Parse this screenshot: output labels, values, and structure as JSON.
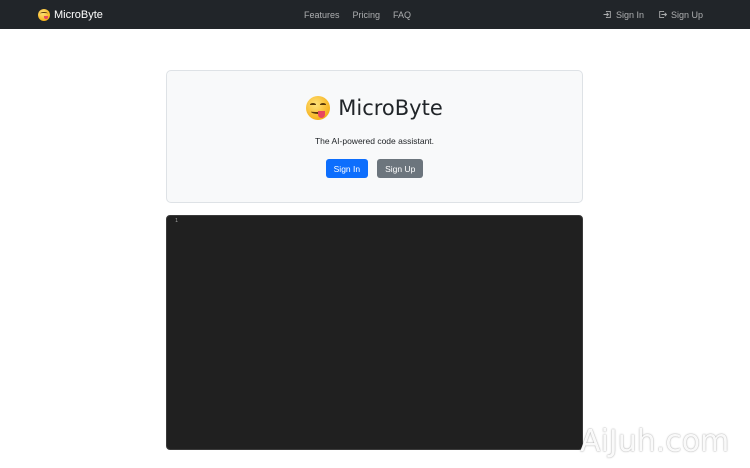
{
  "navbar": {
    "brand": "MicroByte",
    "links": [
      "Features",
      "Pricing",
      "FAQ"
    ],
    "sign_in": "Sign In",
    "sign_up": "Sign Up",
    "icons": {
      "brand": "face-savoring-food-emoji-icon",
      "sign_in": "sign-in-icon",
      "sign_up": "sign-up-icon"
    }
  },
  "hero": {
    "title": "MicroByte",
    "subtitle": "The AI-powered code assistant.",
    "sign_in_button": "Sign In",
    "sign_up_button": "Sign Up"
  },
  "editor": {
    "line_numbers": [
      "1"
    ]
  },
  "watermark": "AiJuh.com",
  "colors": {
    "navbar_bg": "#212529",
    "primary": "#0d6efd",
    "secondary": "#6c757d",
    "editor_bg": "#202020",
    "card_bg": "#f8f9fa"
  }
}
